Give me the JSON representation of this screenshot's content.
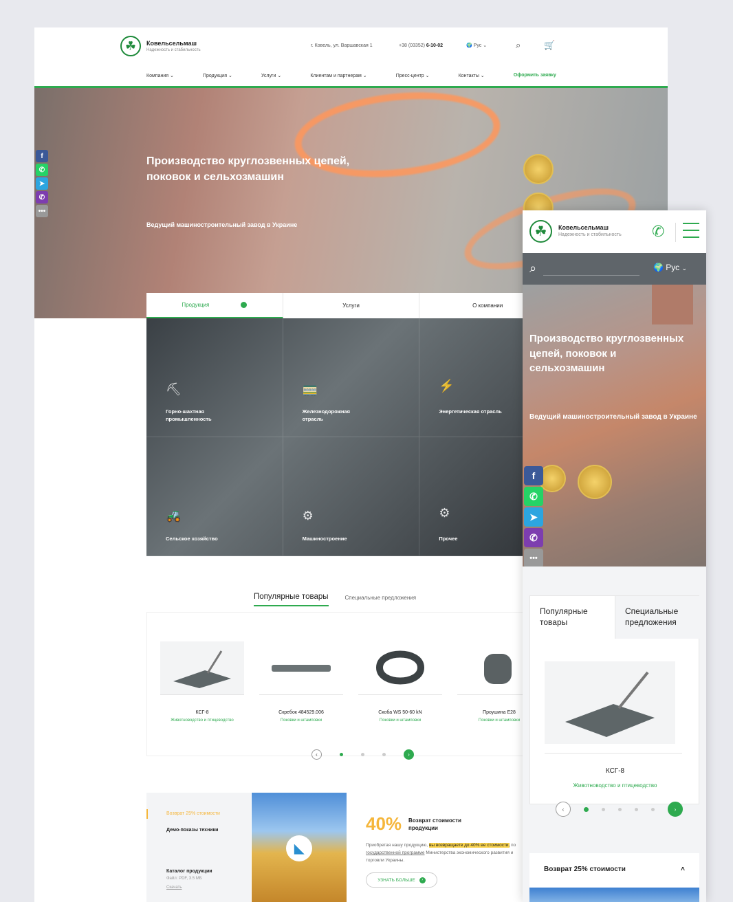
{
  "header": {
    "brand": "Ковельсельмаш",
    "slogan": "Надежность и стабильность",
    "address": "г. Ковель, ул. Варшавская 1",
    "phone_prefix": "+38 (03352)",
    "phone_number": "6-10-02",
    "lang": "Рус"
  },
  "nav": {
    "items": [
      "Компания",
      "Продукция",
      "Услуги",
      "Клиентам и партнерам",
      "Пресс-центр",
      "Контакты"
    ],
    "cta": "Оформить заявку"
  },
  "hero": {
    "title": "Производство круглозвенных цепей, поковок и сельхозмашин",
    "subtitle": "Ведущий машиностроительный завод в Украине"
  },
  "section_tabs": [
    "Продукция",
    "Услуги",
    "О компании"
  ],
  "categories": [
    {
      "label": "Горно-шахтная промышленность",
      "icon": "mining-icon"
    },
    {
      "label": "Железнодорожная отрасль",
      "icon": "railway-icon"
    },
    {
      "label": "Энергетическая отрасль",
      "icon": "power-tower-icon"
    },
    {
      "label": "Сельское хозяйство",
      "icon": "tractor-icon"
    },
    {
      "label": "Машиностроение",
      "icon": "machine-icon"
    },
    {
      "label": "Прочее",
      "icon": "gears-icon"
    }
  ],
  "products_tabs": {
    "popular": "Популярные товары",
    "special": "Специальные предложения"
  },
  "products": [
    {
      "name": "КСГ-8",
      "category": "Животноводство и птицеводство"
    },
    {
      "name": "Скребок 484529.006",
      "category": "Поковки и штамповки"
    },
    {
      "name": "Скоба WS 50-60 kN",
      "category": "Поковки и штамповки"
    },
    {
      "name": "Проушина E28",
      "category": "Поковки и штамповки"
    }
  ],
  "bottom_nav": {
    "return": "Возврат 25% стоимости",
    "demo": "Демо-показы техники",
    "catalog": "Каталог продукции",
    "catalog_file": "Файл: PDF, 3.5 МБ",
    "download": "Скачать"
  },
  "promo": {
    "percent": "40%",
    "title": "Возврат стоимости продукции",
    "text_a": "Приобретая нашу продукцию, ",
    "text_hl": "вы возвращаете до 40% ее стоимости,",
    "text_b": " по ",
    "text_link": "государственной программе",
    "text_c": " Министерства экономического развития и торговли Украины.",
    "button": "УЗНАТЬ БОЛЬШЕ"
  },
  "mobile": {
    "brand": "Ковельсельмаш",
    "slogan": "Надежность и стабильность",
    "lang": "Рус",
    "title": "Производство круглозвенных цепей, поковок и сельхозмашин",
    "subtitle": "Ведущий машиностроительный завод в Украине",
    "tab_popular": "Популярные товары",
    "tab_special": "Специальные предложения",
    "product_name": "КСГ-8",
    "product_category": "Животноводство и птицеводство",
    "accordion": "Возврат 25% стоимости"
  },
  "colors": {
    "accent": "#2eaa4f",
    "promo": "#f5b63b"
  }
}
